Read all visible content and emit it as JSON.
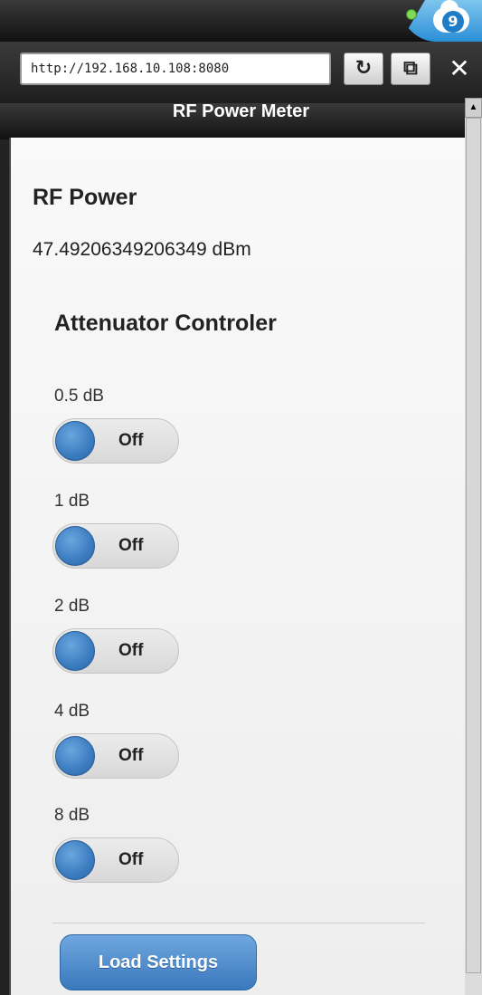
{
  "browser": {
    "url": "http://192.168.10.108:8080",
    "refresh_icon": "↻",
    "window_icon": "⧉",
    "close_icon": "✕",
    "badge": "9"
  },
  "page": {
    "header_title": "RF Power Meter",
    "rf_power_title": "RF Power",
    "rf_power_value": "47.49206349206349 dBm",
    "attenuator_title": "Attenuator Controler"
  },
  "attenuators": [
    {
      "label": "0.5 dB",
      "state": "Off"
    },
    {
      "label": "1 dB",
      "state": "Off"
    },
    {
      "label": "2 dB",
      "state": "Off"
    },
    {
      "label": "4 dB",
      "state": "Off"
    },
    {
      "label": "8 dB",
      "state": "Off"
    }
  ],
  "actions": {
    "load_settings": "Load Settings"
  }
}
